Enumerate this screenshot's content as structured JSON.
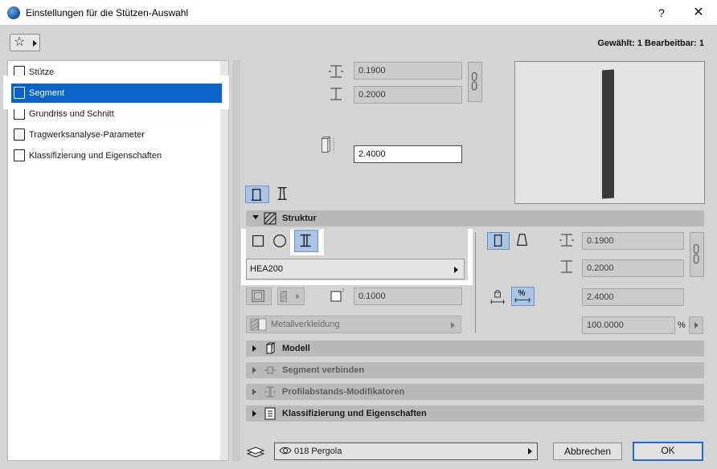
{
  "window": {
    "title": "Einstellungen für die Stützen-Auswahl",
    "help": "?",
    "close": "✕"
  },
  "header": {
    "selected_info": "Gewählt: 1 Bearbeitbar: 1"
  },
  "sidebar": {
    "items": [
      {
        "label": "Stütze",
        "icon": "column-icon"
      },
      {
        "label": "Segment",
        "icon": "segment-icon",
        "active": true
      },
      {
        "label": "Grundriss und Schnitt",
        "icon": "floorplan-icon"
      },
      {
        "label": "Tragwerksanalyse-Parameter",
        "icon": "structural-analysis-icon"
      },
      {
        "label": "Klassifizierung und Eigenschaften",
        "icon": "classification-icon"
      }
    ]
  },
  "top_dims": {
    "width": "0.1900",
    "depth": "0.2000",
    "height": "2.4000"
  },
  "sections": {
    "structure": "Struktur",
    "model": "Modell",
    "connect": "Segment verbinden",
    "profile_mods": "Profilabstands-Modifikatoren",
    "classification": "Klassifizierung und Eigenschaften"
  },
  "structure": {
    "profile": "HEA200",
    "offset": "0.1000",
    "material": "Metallverkleidung",
    "width": "0.1900",
    "depth": "0.2000",
    "height": "2.4000",
    "percent": "100.0000",
    "percent_unit": "%"
  },
  "footer": {
    "layer": "018 Pergola",
    "cancel": "Abbrechen",
    "ok": "OK"
  }
}
